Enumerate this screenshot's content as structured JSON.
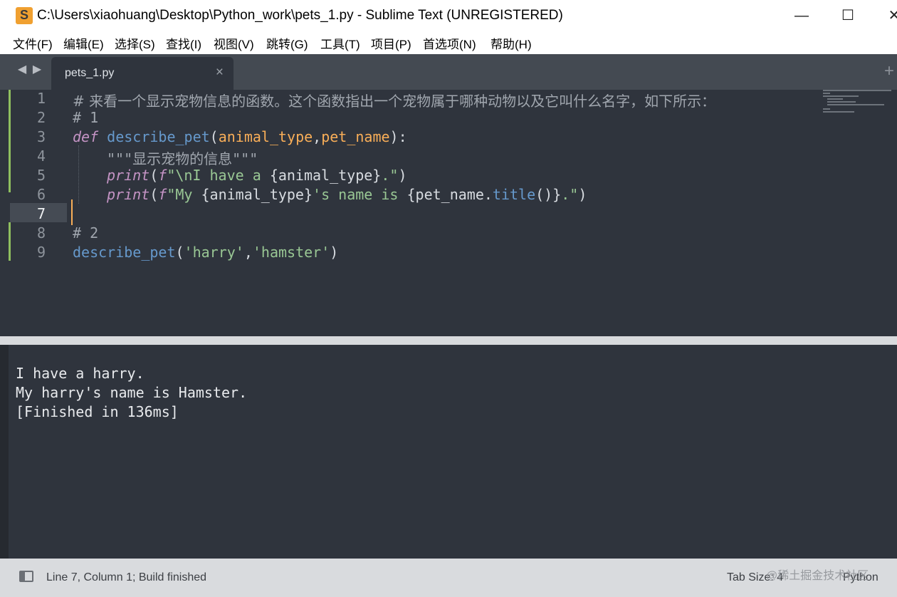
{
  "window": {
    "title": "C:\\Users\\xiaohuang\\Desktop\\Python_work\\pets_1.py - Sublime Text (UNREGISTERED)",
    "minimize_glyph": "—",
    "maximize_glyph": "☐",
    "close_glyph": "✕"
  },
  "menu": [
    "文件(F)",
    "编辑(E)",
    "选择(S)",
    "查找(I)",
    "视图(V)",
    "跳转(G)",
    "工具(T)",
    "项目(P)",
    "首选项(N)",
    "帮助(H)"
  ],
  "tabs": {
    "nav_left": "◀",
    "nav_right": "▶",
    "active": {
      "name": "pets_1.py",
      "close": "×"
    },
    "new": "+"
  },
  "editor": {
    "line_numbers": [
      "1",
      "2",
      "3",
      "4",
      "5",
      "6",
      "7",
      "8",
      "9"
    ],
    "current_line": 7,
    "lines": {
      "l1": "# 来看一个显示宠物信息的函数。这个函数指出一个宠物属于哪种动物以及它叫什么名字，如下所示：",
      "l2": "# 1",
      "l3_kw": "def",
      "l3_fn": "describe_pet",
      "l3_open": "(",
      "l3_p1": "animal_type",
      "l3_comma": ",",
      "l3_p2": "pet_name",
      "l3_close": "):",
      "l4": "\"\"\"显示宠物的信息\"\"\"",
      "l5_print": "print",
      "l5_open": "(",
      "l5_f": "f",
      "l5_s1": "\"\\nI have a ",
      "l5_expr": "{animal_type}",
      "l5_s2": ".\"",
      "l5_close": ")",
      "l6_print": "print",
      "l6_open": "(",
      "l6_f": "f",
      "l6_s1": "\"My ",
      "l6_expr1": "{animal_type}",
      "l6_s2": "'s name is ",
      "l6_expr2a": "{pet_name.",
      "l6_meth": "title",
      "l6_expr2b": "()}",
      "l6_s3": ".\"",
      "l6_close": ")",
      "l8": "# 2",
      "l9_fn": "describe_pet",
      "l9_open": "(",
      "l9_a1": "'harry'",
      "l9_comma": ",",
      "l9_a2": "'hamster'",
      "l9_close": ")"
    }
  },
  "output": [
    "I have a harry.",
    "My harry's name is Hamster.",
    "[Finished in 136ms]"
  ],
  "status": {
    "text": "Line 7, Column 1; Build finished",
    "tab_size": "Tab Size: 4",
    "syntax": "Python",
    "watermark": "@稀土掘金技术社区"
  }
}
